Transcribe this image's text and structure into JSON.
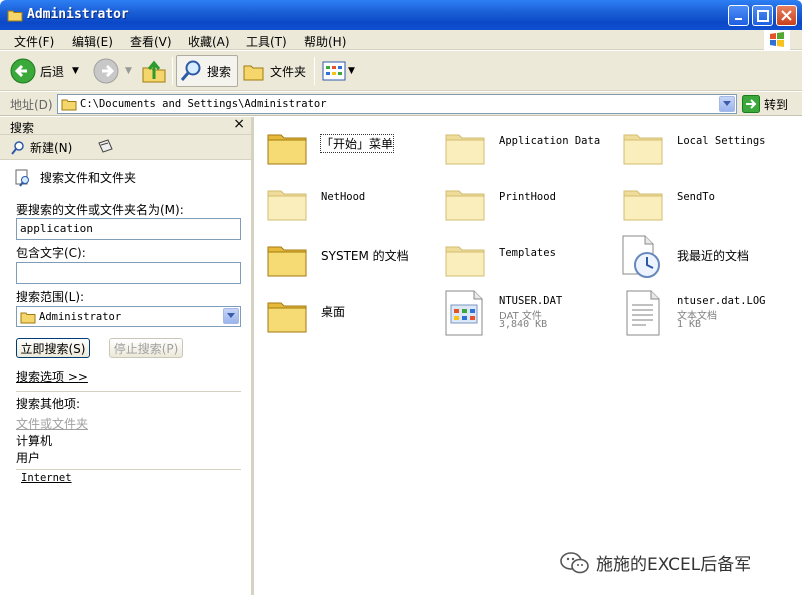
{
  "window": {
    "title": "Administrator"
  },
  "menu": [
    "文件(F)",
    "编辑(E)",
    "查看(V)",
    "收藏(A)",
    "工具(T)",
    "帮助(H)"
  ],
  "toolbar": {
    "back": "后退",
    "search": "搜索",
    "folders": "文件夹"
  },
  "address": {
    "label": "地址(D)",
    "path": "C:\\Documents and Settings\\Administrator",
    "go": "转到"
  },
  "search_pane": {
    "title": "搜索",
    "close": "×",
    "new_label": "新建(N)",
    "search_files_title": "搜索文件和文件夹",
    "name_label": "要搜索的文件或文件夹名为(M):",
    "name_value": "application",
    "contains_label": "包含文字(C):",
    "contains_value": "",
    "lookin_label": "搜索范围(L):",
    "lookin_value": "Administrator",
    "search_now": "立即搜索(S)",
    "stop_search": "停止搜索(P)",
    "options": "搜索选项 >>",
    "other_label": "搜索其他项:",
    "other_items": [
      "文件或文件夹",
      "计算机",
      "用户"
    ],
    "internet": "Internet"
  },
  "files": [
    {
      "name": "「开始」菜单",
      "type": "folder"
    },
    {
      "name": "Application Data",
      "type": "folder-faded"
    },
    {
      "name": "Local Settings",
      "type": "folder-faded"
    },
    {
      "name": "NetHood",
      "type": "folder-faded"
    },
    {
      "name": "PrintHood",
      "type": "folder-faded"
    },
    {
      "name": "SendTo",
      "type": "folder-faded"
    },
    {
      "name": "SYSTEM 的文档",
      "type": "folder"
    },
    {
      "name": "Templates",
      "type": "folder-faded"
    },
    {
      "name": "我最近的文档",
      "type": "recent"
    },
    {
      "name": "桌面",
      "type": "folder"
    },
    {
      "name": "NTUSER.DAT",
      "type": "dat",
      "sub1": "DAT 文件",
      "sub2": "3,840 KB"
    },
    {
      "name": "ntuser.dat.LOG",
      "type": "txt",
      "sub1": "文本文档",
      "sub2": "1 KB"
    }
  ],
  "watermark": "施施的EXCEL后备军",
  "colors": {
    "titlebar": "#0a48c8",
    "chrome": "#ece9d8",
    "folder": "#f2d267"
  }
}
